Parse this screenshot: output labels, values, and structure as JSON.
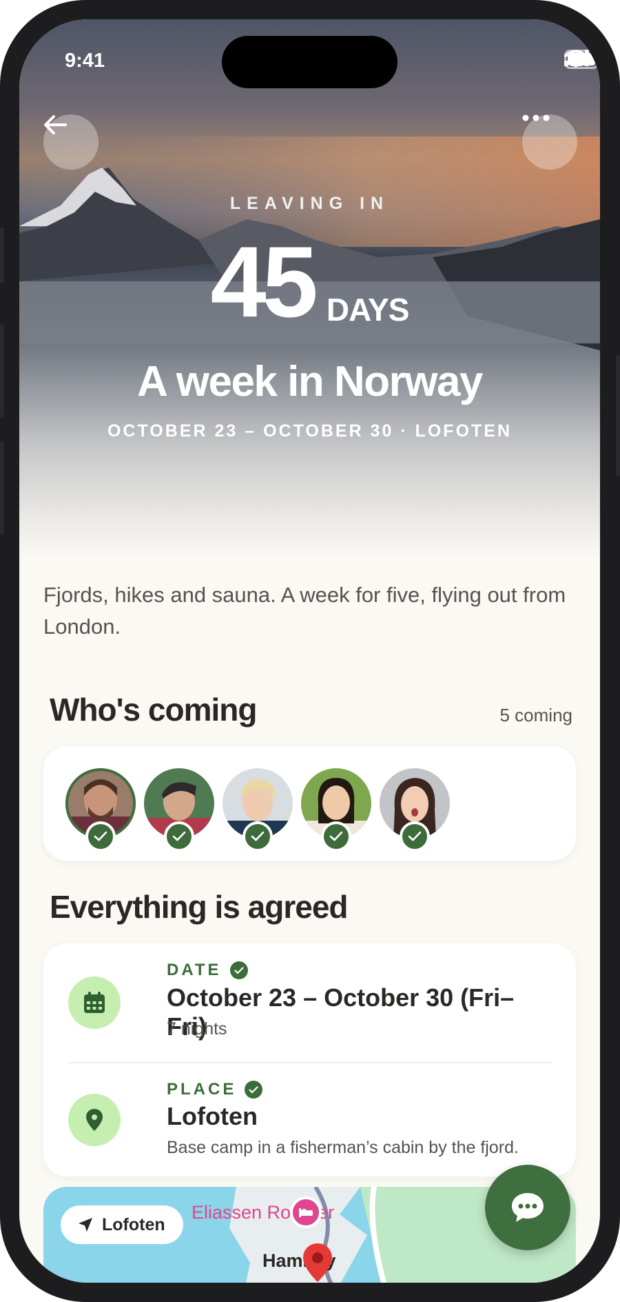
{
  "status_bar": {
    "time": "9:41"
  },
  "hero": {
    "leaving_label": "LEAVING IN",
    "countdown_number": "45",
    "countdown_unit": "DAYS",
    "title": "A week in Norway",
    "subtitle": "OCTOBER 23 – OCTOBER 30 · LOFOTEN"
  },
  "description": "Fjords, hikes and sauna. A week for five, flying out from London.",
  "participants": {
    "title": "Who's coming",
    "count_label": "5 coming",
    "people": [
      {
        "name": "avatar-1",
        "confirmed": true
      },
      {
        "name": "avatar-2",
        "confirmed": true
      },
      {
        "name": "avatar-3",
        "confirmed": true
      },
      {
        "name": "avatar-4",
        "confirmed": true
      },
      {
        "name": "avatar-5",
        "confirmed": true
      }
    ]
  },
  "agreement": {
    "title": "Everything is agreed",
    "date": {
      "label": "DATE",
      "value": "October 23 – October 30 (Fri–Fri)",
      "note": "7 nights",
      "icon": "calendar-icon"
    },
    "place": {
      "label": "PLACE",
      "value": "Lofoten",
      "note": "Base camp in a fisherman’s cabin by the fjord.",
      "icon": "location-pin-icon"
    }
  },
  "map": {
    "chip_label": "Lofoten",
    "poi_label": "Eliassen Rorbuer",
    "place_label": "Hamnøy",
    "icons": [
      "navigation-arrow-icon",
      "hotel-icon",
      "map-pin-icon"
    ]
  },
  "fab": {
    "icon": "chat-bubble-icon"
  },
  "colors": {
    "accent_green": "#3f6e3f",
    "icon_bg": "#c6eeb1",
    "page_bg": "#fbf9f4",
    "map_water": "#8ad5e9",
    "poi_pink": "#e0458f"
  }
}
